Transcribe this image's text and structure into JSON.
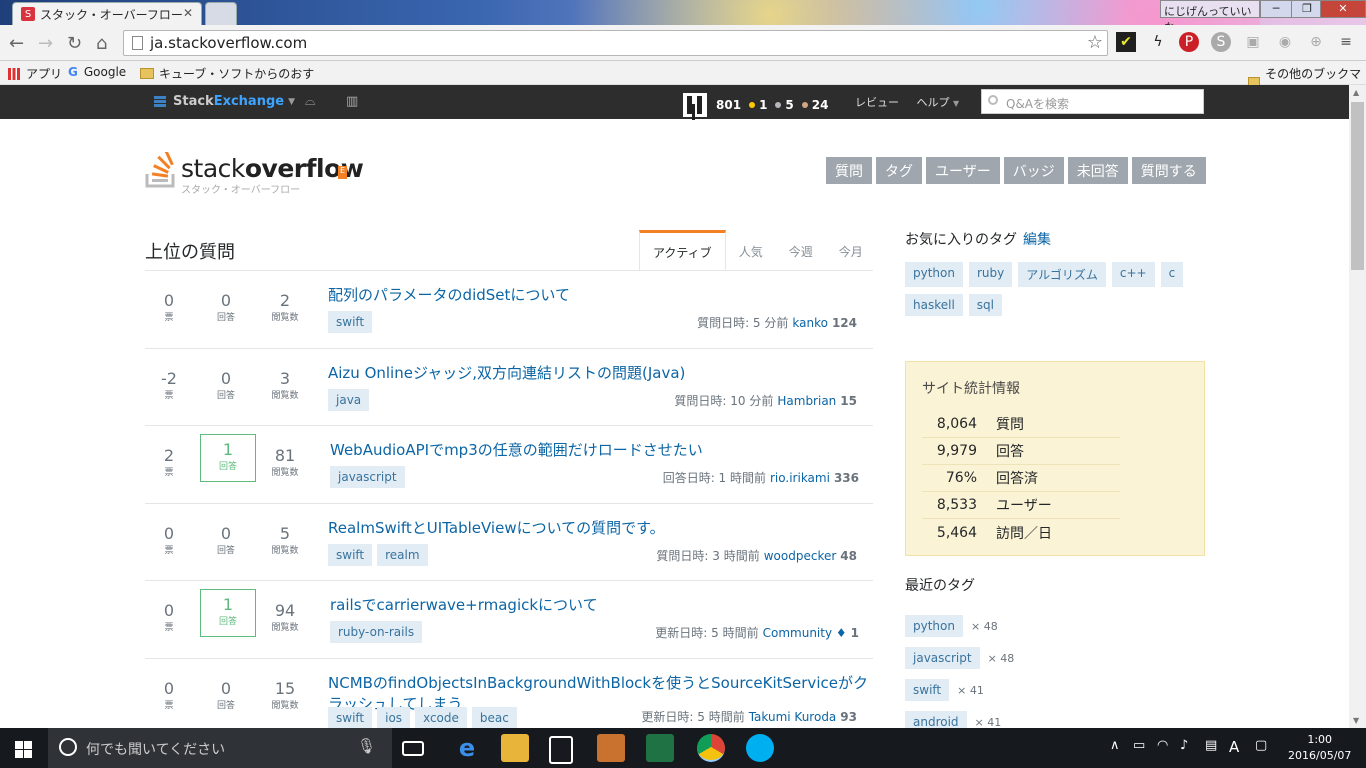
{
  "browser": {
    "tab_title": "スタック・オーバーフロー",
    "url": "ja.stackoverflow.com",
    "user_chip": "にじげんっていいな。",
    "bookmarks": [
      "アプリ",
      "Google",
      "キューブ・ソフトからのおす"
    ],
    "other_bookmarks": "その他のブックマーク"
  },
  "se_bar": {
    "brand_a": "Stack",
    "brand_b": "Exchange",
    "reputation": "801",
    "gold": "1",
    "silver": "5",
    "bronze": "24",
    "review": "レビュー",
    "help": "ヘルプ",
    "search_placeholder": "Q&Aを検索"
  },
  "site": {
    "logo_a": "stack",
    "logo_b": "overflow",
    "logo_sub": "スタック・オーバーフロー",
    "nav": [
      "質問",
      "タグ",
      "ユーザー",
      "バッジ",
      "未回答",
      "質問する"
    ]
  },
  "main": {
    "title": "上位の質問",
    "tabs": [
      "アクティブ",
      "人気",
      "今週",
      "今月"
    ],
    "stat_labels": {
      "votes": "票",
      "answers": "回答",
      "views": "閲覧数"
    },
    "questions": [
      {
        "votes": "0",
        "answers": "0",
        "views": "2",
        "title": "配列のパラメータのdidSetについて",
        "title2": "",
        "tags": [
          "swift"
        ],
        "meta": "質問日時: 5 分前",
        "user": "kanko",
        "rep": "124"
      },
      {
        "votes": "-2",
        "answers": "0",
        "views": "3",
        "title": "Aizu Onlineジャッジ,双方向連結リストの問題(Java)",
        "title2": "",
        "tags": [
          "java"
        ],
        "meta": "質問日時: 10 分前",
        "user": "Hambrian",
        "rep": "15"
      },
      {
        "votes": "2",
        "answers": "1",
        "views": "81",
        "title": "WebAudioAPIでmp3の任意の範囲だけロードさせたい",
        "title2": "",
        "tags": [
          "javascript"
        ],
        "meta": "回答日時: 1 時間前",
        "user": "rio.irikami",
        "rep": "336"
      },
      {
        "votes": "0",
        "answers": "0",
        "views": "5",
        "title": "RealmSwiftとUITableViewについての質問です。",
        "title2": "",
        "tags": [
          "swift",
          "realm"
        ],
        "meta": "質問日時: 3 時間前",
        "user": "woodpecker",
        "rep": "48"
      },
      {
        "votes": "0",
        "answers": "1",
        "views": "94",
        "title": "railsでcarrierwave+rmagickについて",
        "title2": "",
        "tags": [
          "ruby-on-rails"
        ],
        "meta": "更新日時: 5 時間前",
        "user": "Community ♦",
        "rep": "1"
      },
      {
        "votes": "0",
        "answers": "0",
        "views": "15",
        "title": "NCMBのfindObjectsInBackgroundWithBlockを使うとSourceKitServiceがク",
        "title2": "ラッシュしてしまう",
        "tags": [
          "swift",
          "ios",
          "xcode",
          "beac"
        ],
        "meta": "更新日時: 5 時間前",
        "user": "Takumi Kuroda",
        "rep": "93"
      }
    ]
  },
  "sidebar": {
    "fav_title": "お気に入りのタグ",
    "fav_edit": "編集",
    "fav_tags": [
      "python",
      "ruby",
      "アルゴリズム",
      "c++",
      "c",
      "haskell",
      "sql"
    ],
    "stats_title": "サイト統計情報",
    "stats": [
      {
        "value": "8,064",
        "label": "質問"
      },
      {
        "value": "9,979",
        "label": "回答"
      },
      {
        "value": "76%",
        "label": "回答済"
      },
      {
        "value": "8,533",
        "label": "ユーザー"
      },
      {
        "value": "5,464",
        "label": "訪問／日"
      }
    ],
    "recent_title": "最近のタグ",
    "recent_tags": [
      {
        "name": "python",
        "count": "× 48"
      },
      {
        "name": "javascript",
        "count": "× 48"
      },
      {
        "name": "swift",
        "count": "× 41"
      },
      {
        "name": "android",
        "count": "× 41"
      }
    ]
  },
  "taskbar": {
    "search_placeholder": "何でも聞いてください",
    "time": "1:00",
    "date": "2016/05/07",
    "ime": "A"
  }
}
